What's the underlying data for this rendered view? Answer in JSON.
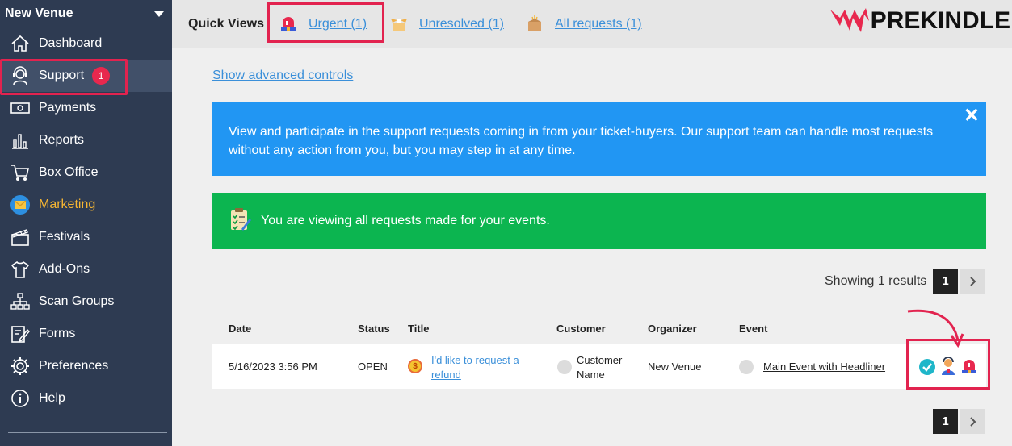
{
  "sidebar": {
    "venue": "New Venue",
    "items": [
      {
        "label": "Dashboard",
        "icon": "home-icon"
      },
      {
        "label": "Support",
        "icon": "headset-icon",
        "badge": "1"
      },
      {
        "label": "Payments",
        "icon": "banknote-icon"
      },
      {
        "label": "Reports",
        "icon": "bar-chart-icon"
      },
      {
        "label": "Box Office",
        "icon": "cart-icon"
      },
      {
        "label": "Marketing",
        "icon": "envelope-icon"
      },
      {
        "label": "Festivals",
        "icon": "clapperboard-icon"
      },
      {
        "label": "Add-Ons",
        "icon": "tshirt-icon"
      },
      {
        "label": "Scan Groups",
        "icon": "org-chart-icon"
      },
      {
        "label": "Forms",
        "icon": "form-edit-icon"
      },
      {
        "label": "Preferences",
        "icon": "gear-icon"
      },
      {
        "label": "Help",
        "icon": "info-icon"
      }
    ]
  },
  "topbar": {
    "label": "Quick Views",
    "links": [
      {
        "label": "Urgent (1)",
        "icon": "siren-icon"
      },
      {
        "label": "Unresolved (1)",
        "icon": "open-box-icon"
      },
      {
        "label": "All requests (1)",
        "icon": "box-icon"
      }
    ],
    "logo": "PREKINDLE"
  },
  "main": {
    "advanced_link": "Show advanced controls",
    "info": "View and participate in the support requests coming in from your ticket-buyers. Our support team can handle most requests without any action from you, but you may step in at any time.",
    "notice": "You are viewing all requests made for your events.",
    "showing": "Showing 1 results",
    "page": "1",
    "columns": [
      "Date",
      "Status",
      "Title",
      "Customer",
      "Organizer",
      "Event"
    ],
    "rows": [
      {
        "date": "5/16/2023 3:56 PM",
        "status": "OPEN",
        "title_line1": "I'd like to request a",
        "title_line2": "refund",
        "customer_line1": "Customer",
        "customer_line2": "Name",
        "organizer": "New Venue",
        "event": "Main Event with Headliner"
      }
    ]
  },
  "colors": {
    "sidebar": "#2e3b52",
    "accent_red": "#e2234f",
    "info_blue": "#2196f3",
    "notice_green": "#0cb550",
    "link": "#3a8fd9",
    "marketing": "#f5b533"
  }
}
